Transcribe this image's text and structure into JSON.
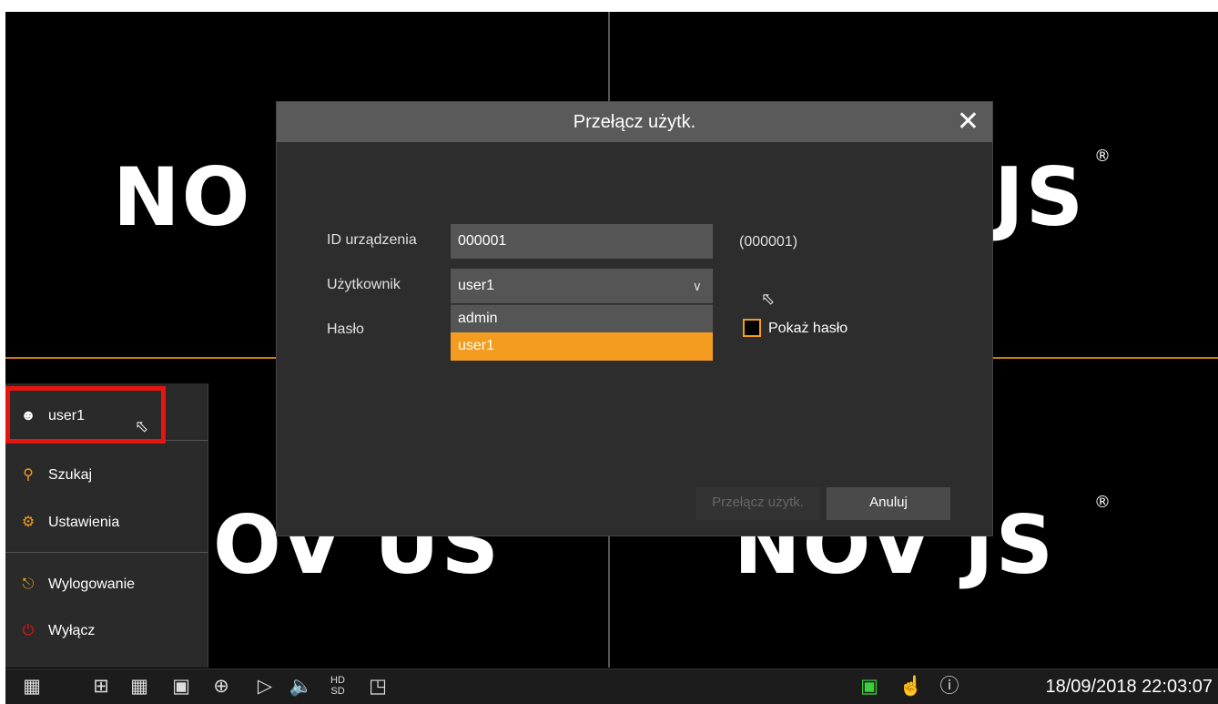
{
  "background": {
    "logo_left_top": "NO",
    "logo_right_top": "JS",
    "logo_left_bottom": "OV US",
    "logo_right_bottom": "NOV JS",
    "registered": "®"
  },
  "dialog": {
    "title": "Przełącz użytk.",
    "close_glyph": "✕",
    "device_id_label": "ID urządzenia",
    "device_id_value": "000001",
    "device_id_hint": "(000001)",
    "user_label": "Użytkownik",
    "user_value": "user1",
    "user_options": [
      "admin",
      "user1"
    ],
    "password_label": "Hasło",
    "show_password_label": "Pokaż hasło",
    "switch_button": "Przełącz użytk.",
    "cancel_button": "Anuluj"
  },
  "side_menu": {
    "user": "user1",
    "items": [
      "Szukaj",
      "Ustawienia",
      "Wylogowanie",
      "Wyłącz"
    ]
  },
  "taskbar": {
    "datetime": "18/09/2018 22:03:07",
    "hd_sd_label_top": "HD",
    "hd_sd_label_bottom": "SD"
  },
  "colors": {
    "accent": "#f39c1f",
    "highlight_frame": "#e8140f",
    "power_icon": "#e8140f"
  }
}
